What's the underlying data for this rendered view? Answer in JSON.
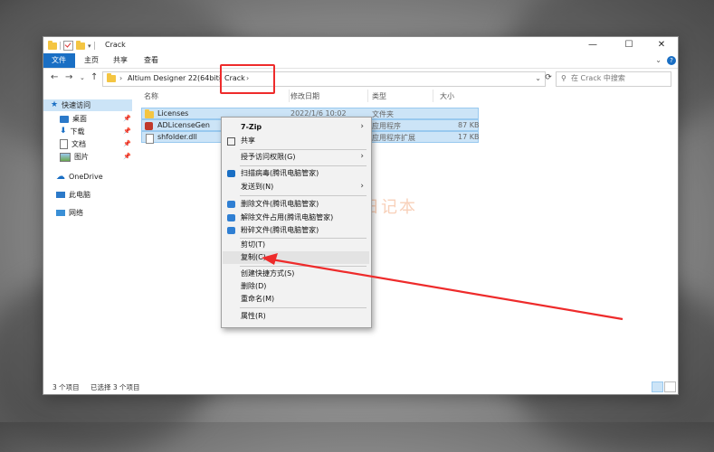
{
  "window": {
    "title": "Crack",
    "controls": [
      "—",
      "☐",
      "✕"
    ]
  },
  "ribbon": {
    "tabs": [
      "文件",
      "主页",
      "共享",
      "查看"
    ],
    "help": "?"
  },
  "address": {
    "path": [
      "Altium Designer 22(64bit)",
      "Crack"
    ],
    "search_placeholder": "在 Crack 中搜索"
  },
  "sidebar": {
    "items": [
      {
        "label": "快速访问",
        "icon": "star-icon"
      },
      {
        "label": "桌面",
        "icon": "desktop-icon",
        "pinned": true
      },
      {
        "label": "下载",
        "icon": "download-icon",
        "pinned": true
      },
      {
        "label": "文档",
        "icon": "document-icon",
        "pinned": true
      },
      {
        "label": "图片",
        "icon": "picture-icon",
        "pinned": true
      },
      {
        "label": "OneDrive",
        "icon": "cloud-icon"
      },
      {
        "label": "此电脑",
        "icon": "computer-icon"
      },
      {
        "label": "网络",
        "icon": "network-icon"
      }
    ]
  },
  "columns": [
    "名称",
    "修改日期",
    "类型",
    "大小"
  ],
  "files": [
    {
      "name": "Licenses",
      "date": "2022/1/6 10:02",
      "type": "文件夹",
      "size": "",
      "icon": "folder-icon"
    },
    {
      "name": "ADLicenseGen",
      "date": "",
      "type": "应用程序",
      "size": "87 KB",
      "icon": "app-icon"
    },
    {
      "name": "shfolder.dll",
      "date": "",
      "type": "应用程序扩展",
      "size": "17 KB",
      "icon": "dll-icon"
    }
  ],
  "context_menu": {
    "items": [
      {
        "label": "7-Zip",
        "bold": true,
        "submenu": true
      },
      {
        "label": "共享",
        "icon": "share-icon"
      },
      {
        "label": "授予访问权限(G)",
        "submenu": true
      },
      {
        "label": "扫描病毒(腾讯电脑管家)",
        "icon": "shield-icon"
      },
      {
        "label": "发送到(N)",
        "submenu": true
      },
      {
        "label": "删除文件(腾讯电脑管家)",
        "icon": "delete-file-icon"
      },
      {
        "label": "解除文件占用(腾讯电脑管家)",
        "icon": "unlock-icon"
      },
      {
        "label": "粉碎文件(腾讯电脑管家)",
        "icon": "shred-icon"
      },
      {
        "label": "剪切(T)"
      },
      {
        "label": "复制(C)",
        "highlighted": true
      },
      {
        "label": "创建快捷方式(S)"
      },
      {
        "label": "删除(D)"
      },
      {
        "label": "重命名(M)"
      },
      {
        "label": "属性(R)"
      }
    ]
  },
  "status": {
    "count": "3 个项目",
    "selected": "已选择 3 个项目"
  },
  "watermark": "丁同学日记本",
  "colors": {
    "accent": "#1a6fc4",
    "selection": "#cce4f7",
    "annotation": "#ee2b2b"
  }
}
